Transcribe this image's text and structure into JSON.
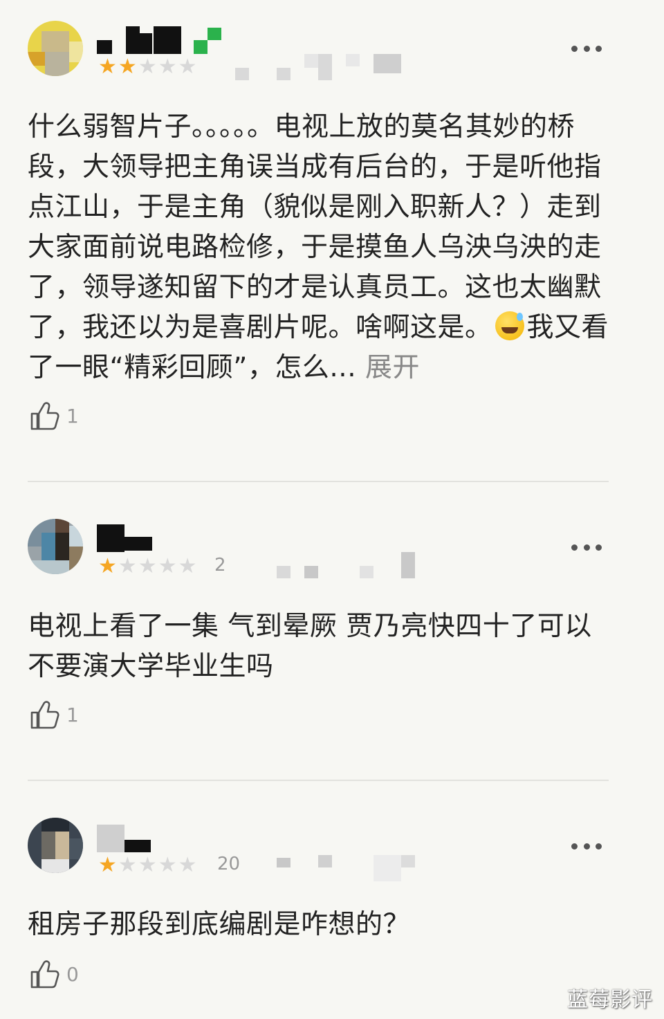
{
  "comments": [
    {
      "rating": 2,
      "meta": "",
      "text": "什么弱智片子。。。。。电视上放的莫名其妙的桥段，大领导把主角误当成有后台的，于是听他指点江山，于是主角（貌似是刚入职新人？）走到大家面前说电路检修，于是摸鱼人乌泱乌泱的走了，领导遂知留下的才是认真员工。这也太幽默了，我还以为是喜剧片呢。啥啊这是。",
      "text_after_emoji": "我又看了一眼“精彩回顾”，怎么...",
      "expand_label": "展开",
      "likes": "1",
      "emoji_icon": "sweat-smile-emoji-icon"
    },
    {
      "rating": 1,
      "meta": "2",
      "text": "电视上看了一集 气到晕厥 贾乃亮快四十了可以不要演大学毕业生吗",
      "likes": "1"
    },
    {
      "rating": 1,
      "meta": "20",
      "text": "租房子那段到底编剧是咋想的？",
      "likes": "0"
    }
  ],
  "icons": {
    "like": "thumbs-up-icon",
    "more": "more-dots-icon",
    "star": "star-icon"
  },
  "colors": {
    "star_on": "#f5a623",
    "star_off": "#d8d8d8",
    "background": "#f7f7f3",
    "expand": "#888888"
  },
  "watermark": "蓝莓影评"
}
